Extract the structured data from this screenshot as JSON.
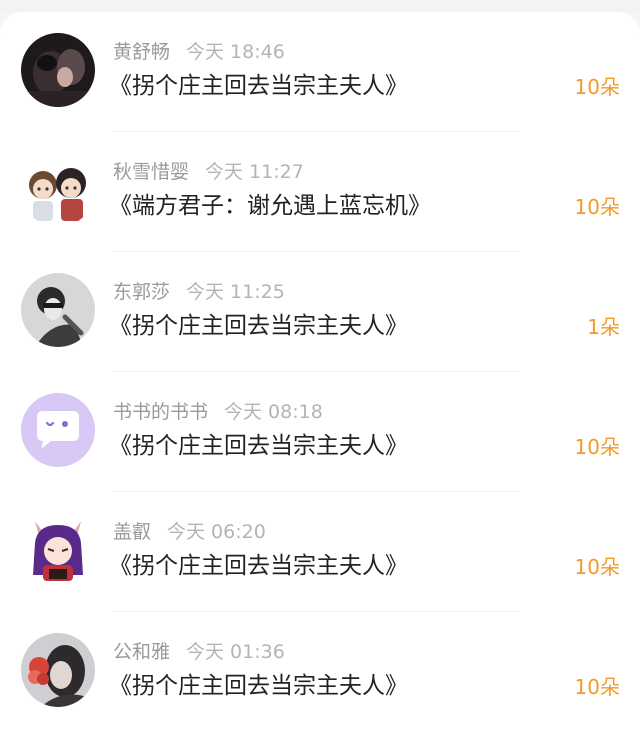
{
  "gifts": [
    {
      "name": "黄舒畅",
      "time": "今天 18:46",
      "book": "《拐个庄主回去当宗主夫人》",
      "amount": "10朵",
      "avatar_icon": "dark-portrait-avatar-icon"
    },
    {
      "name": "秋雪惜婴",
      "time": "今天 11:27",
      "book": "《端方君子：谢允遇上蓝忘机》",
      "amount": "10朵",
      "avatar_icon": "chibi-couple-avatar-icon"
    },
    {
      "name": "东郭莎",
      "time": "今天 11:25",
      "book": "《拐个庄主回去当宗主夫人》",
      "amount": "1朵",
      "avatar_icon": "grayscale-portrait-avatar-icon"
    },
    {
      "name": "书书的书书",
      "time": "今天 08:18",
      "book": "《拐个庄主回去当宗主夫人》",
      "amount": "10朵",
      "avatar_icon": "chat-bubble-avatar-icon"
    },
    {
      "name": "盖叡",
      "time": "今天 06:20",
      "book": "《拐个庄主回去当宗主夫人》",
      "amount": "10朵",
      "avatar_icon": "anime-girl-avatar-icon"
    },
    {
      "name": "公和雅",
      "time": "今天 01:36",
      "book": "《拐个庄主回去当宗主夫人》",
      "amount": "10朵",
      "avatar_icon": "flower-portrait-avatar-icon"
    }
  ],
  "colors": {
    "accent": "#f39a2c",
    "name": "#9a9a9a",
    "title": "#222222",
    "bubble": "#d8c8f5"
  }
}
